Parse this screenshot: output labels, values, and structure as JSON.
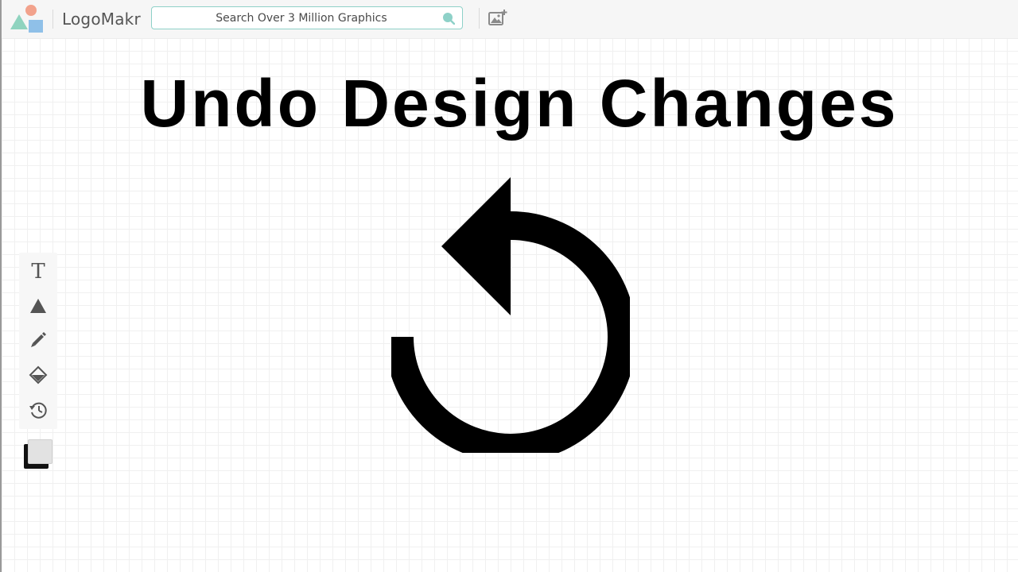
{
  "header": {
    "logo_text": "LogoMakr",
    "search": {
      "placeholder": "Search Over 3 Million Graphics",
      "value": ""
    }
  },
  "icons": {
    "logo": "logo-shapes-icon",
    "search": "search-icon",
    "add_image": "add-image-icon",
    "text_tool": "text-icon",
    "shape_tool": "triangle-icon",
    "draw_tool": "pencil-icon",
    "background_tool": "paint-bucket-icon",
    "history_tool": "history-icon",
    "undo_graphic": "undo-arrow-icon"
  },
  "canvas": {
    "title": "Undo Design Changes"
  },
  "toolbar": {
    "text_tool_glyph": "T"
  },
  "colors": {
    "accent_teal": "#8ed1c8",
    "logo_teal": "#8fd3bf",
    "logo_coral": "#f2a28c",
    "logo_blue": "#8fc0e8",
    "primary_color": "#111111",
    "secondary_color": "#e2e2e2"
  }
}
